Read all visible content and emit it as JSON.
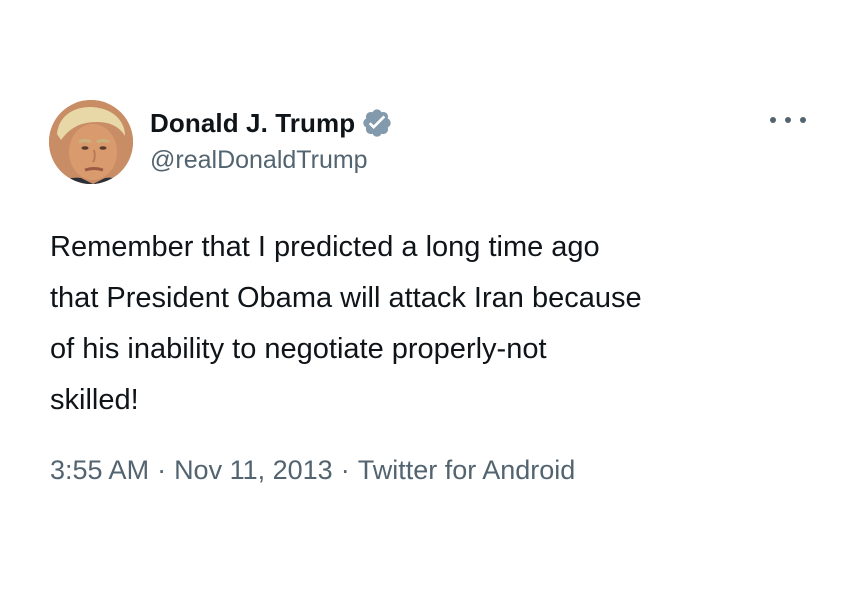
{
  "tweet": {
    "author": {
      "display_name": "Donald J. Trump",
      "handle": "@realDonaldTrump",
      "verified": true,
      "avatar_icon": "profile-photo"
    },
    "more_icon": "more-horizontal-icon",
    "text": "Remember that I predicted a long time ago\nthat President Obama will attack Iran because\nof his inability to negotiate properly-not\nskilled!",
    "meta": {
      "time": "3:55 AM",
      "separator": "·",
      "date": "Nov 11, 2013",
      "source": "Twitter for Android"
    }
  },
  "colors": {
    "text_primary": "#0f1419",
    "text_secondary": "#536471",
    "verified_badge": "#829aab"
  }
}
